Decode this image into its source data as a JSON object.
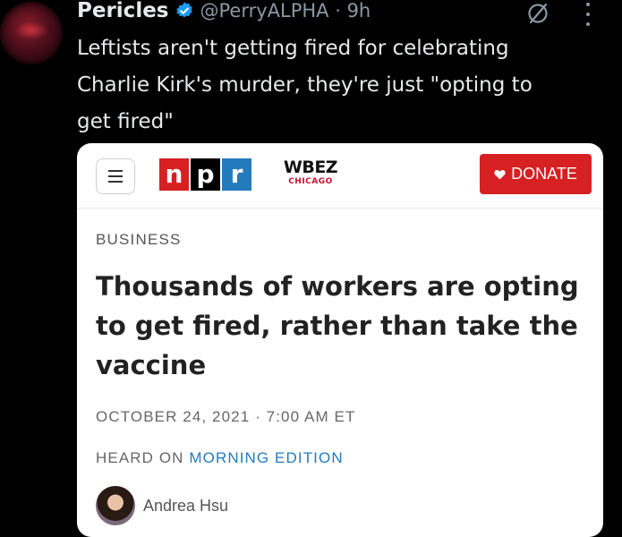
{
  "tweet": {
    "display_name": "Pericles",
    "handle_time": "@PerryALPHA · 9h",
    "text": "Leftists aren't getting fired for celebrating\nCharlie Kirk's murder, they're just \"opting to\nget fired\""
  },
  "icons": {
    "verified": "verified-badge-icon",
    "grok": "grok-slash-circle-icon",
    "more": "vertical-ellipsis-icon"
  },
  "colors": {
    "verified_blue": "#1d9bf0",
    "npr_red": "#d62021",
    "npr_blue": "#237bbd",
    "donate_red": "#d62021",
    "link_blue": "#237bbd"
  },
  "card": {
    "logo_letters": [
      "n",
      "p",
      "r"
    ],
    "station_name": "WBEZ",
    "station_city": "CHICAGO",
    "donate_label": "DONATE",
    "section": "BUSINESS",
    "headline": "Thousands of workers are opting to get fired, rather than take the vaccine",
    "dateline": "OCTOBER 24, 2021 · 7:00 AM ET",
    "heard_on": "HEARD ON",
    "show_name": "MORNING EDITION",
    "author": "Andrea Hsu"
  }
}
